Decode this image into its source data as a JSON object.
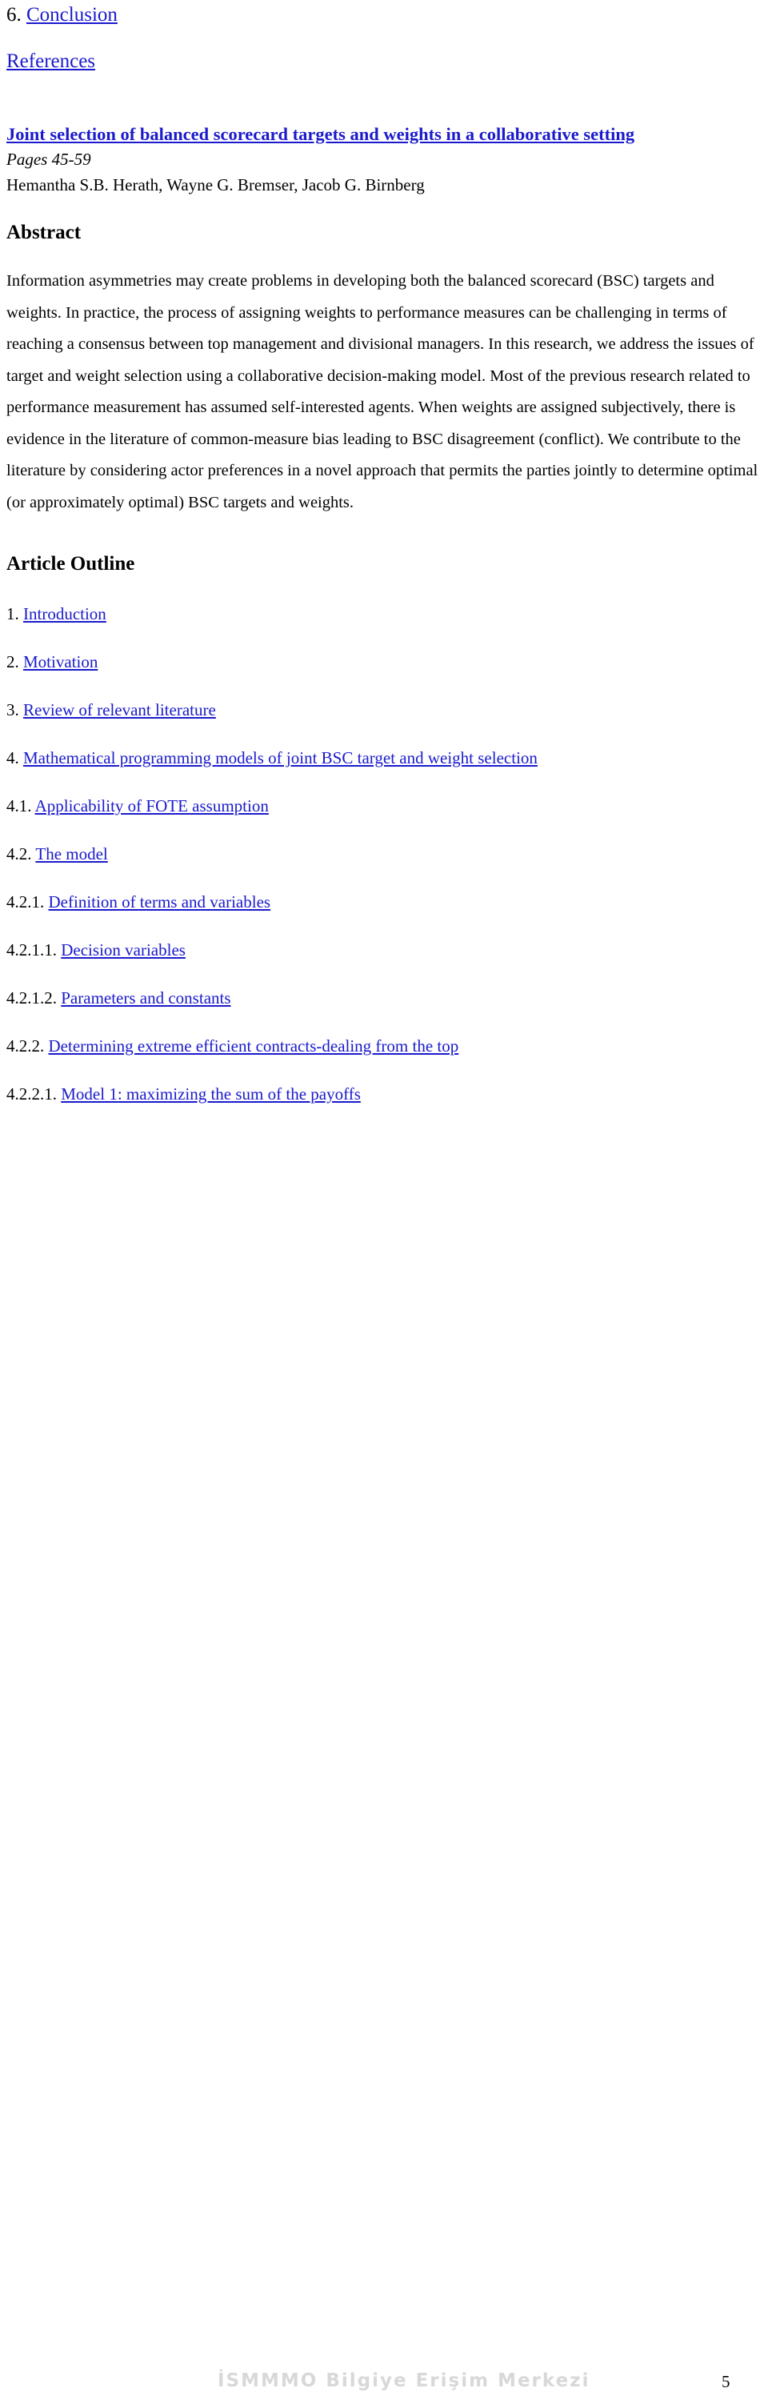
{
  "document": {
    "toc_top": [
      {
        "number": "6.",
        "label": "Conclusion"
      },
      {
        "number": "",
        "label": "References"
      }
    ],
    "article": {
      "title": "Joint selection of balanced scorecard targets and weights in a collaborative setting",
      "pages": "Pages 45-59",
      "authors": "Hemantha S.B. Herath, Wayne G. Bremser, Jacob G. Birnberg"
    },
    "abstract": {
      "heading": "Abstract",
      "text": "Information asymmetries may create problems in developing both the balanced scorecard (BSC) targets and weights. In practice, the process of assigning weights to performance measures can be challenging in terms of reaching a consensus between top management and divisional managers. In this research, we address the issues of target and weight selection using a collaborative decision-making model. Most of the previous research related to performance measurement has assumed self-interested agents. When weights are assigned subjectively, there is evidence in the literature of common-measure bias leading to BSC disagreement (conflict). We contribute to the literature by considering actor preferences in a novel approach that permits the parties jointly to determine optimal (or approximately optimal) BSC targets and weights."
    },
    "outline": {
      "heading": "Article Outline",
      "items": [
        {
          "number": "1.",
          "label": "Introduction"
        },
        {
          "number": "2.",
          "label": "Motivation"
        },
        {
          "number": "3.",
          "label": "Review of relevant literature"
        },
        {
          "number": "4.",
          "label": "Mathematical programming models of joint BSC target and weight selection"
        },
        {
          "number": "4.1.",
          "label": "Applicability of FOTE assumption"
        },
        {
          "number": "4.2.",
          "label": "The model"
        },
        {
          "number": "4.2.1.",
          "label": "Definition of terms and variables"
        },
        {
          "number": "4.2.1.1.",
          "label": "Decision variables"
        },
        {
          "number": "4.2.1.2.",
          "label": "Parameters and constants"
        },
        {
          "number": "4.2.2.",
          "label": "Determining extreme efficient contracts-dealing from the top"
        },
        {
          "number": "4.2.2.1.",
          "label": "Model 1: maximizing the sum of the payoffs"
        }
      ]
    },
    "footer": {
      "watermark": "İSMMMO  Bilgiye  Erişim  Merkezi",
      "page_number": "5"
    }
  }
}
